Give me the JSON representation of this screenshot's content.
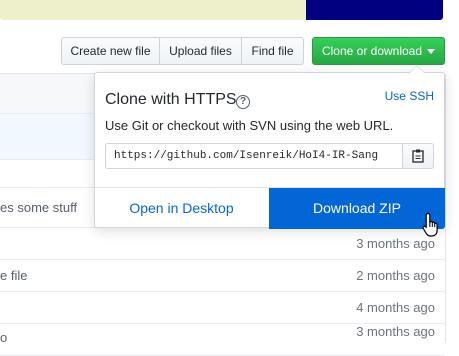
{
  "toolbar": {
    "create_new_file": "Create new file",
    "upload_files": "Upload files",
    "find_file": "Find file",
    "clone_or_download": "Clone or download"
  },
  "clone_popover": {
    "title": "Clone with HTTPS",
    "use_ssh": "Use SSH",
    "description": "Use Git or checkout with SVN using the web URL.",
    "url": "https://github.com/Isenreik/HoI4-IR-Sang",
    "open_in_desktop": "Open in Desktop",
    "download_zip": "Download ZIP"
  },
  "file_rows": [
    {
      "message": "es some stuff",
      "age": ""
    },
    {
      "message": "",
      "age": "3 months ago"
    },
    {
      "message": "e file",
      "age": "2 months ago"
    },
    {
      "message": "",
      "age": "4 months ago"
    },
    {
      "message": "o",
      "age": "3 months ago"
    }
  ],
  "colors": {
    "accent_blue": "#0366d6",
    "clone_green": "#28a745",
    "lang_bar_primary": "#eef0cc",
    "lang_bar_secondary": "#000080"
  },
  "icons": {
    "help": "question-circle-icon",
    "copy": "clipboard-icon",
    "cursor": "hand-pointer-icon",
    "caret": "triangle-down-icon"
  }
}
